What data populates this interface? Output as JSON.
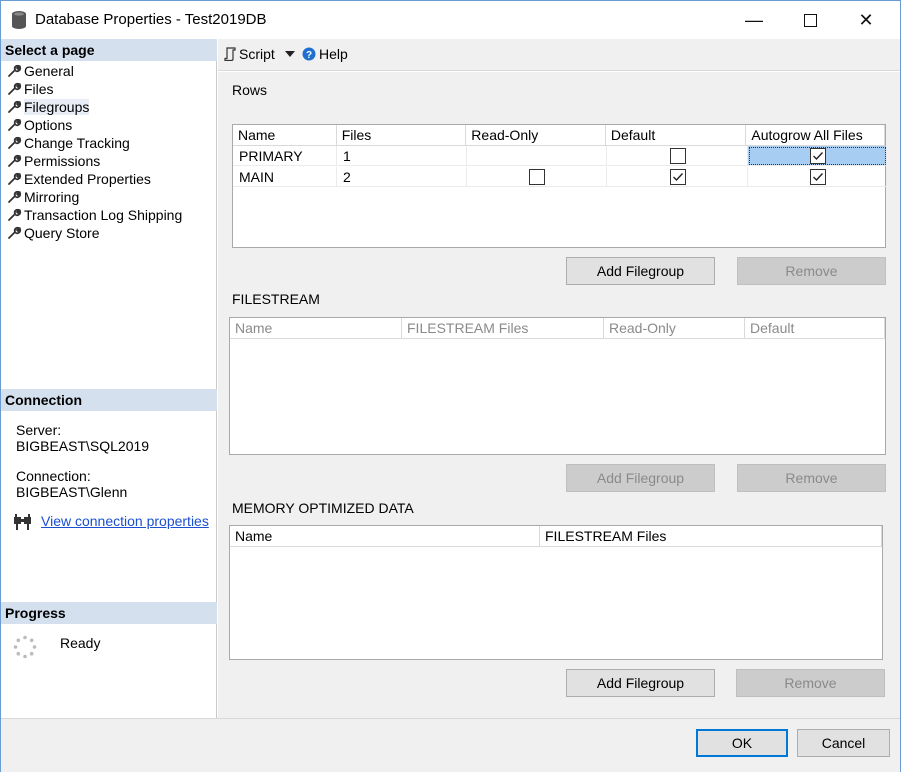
{
  "window": {
    "title": "Database Properties - Test2019DB",
    "minimize_glyph": "—",
    "close_glyph": "✕"
  },
  "left": {
    "select_page_header": "Select a page",
    "pages": [
      "General",
      "Files",
      "Filegroups",
      "Options",
      "Change Tracking",
      "Permissions",
      "Extended Properties",
      "Mirroring",
      "Transaction Log Shipping",
      "Query Store"
    ],
    "selected_page": "Filegroups",
    "connection_header": "Connection",
    "server_label": "Server:",
    "server_value": "BIGBEAST\\SQL2019",
    "connection_label": "Connection:",
    "connection_value": "BIGBEAST\\Glenn",
    "view_connection_link": "View connection properties",
    "progress_header": "Progress",
    "progress_status": "Ready"
  },
  "toolbar": {
    "script_label": "Script",
    "help_label": "Help"
  },
  "rows_section": {
    "label": "Rows",
    "columns": [
      "Name",
      "Files",
      "Read-Only",
      "Default",
      "Autogrow All Files"
    ],
    "rows": [
      {
        "name": "PRIMARY",
        "files": "1",
        "read_only": null,
        "default": false,
        "autogrow": true
      },
      {
        "name": "MAIN",
        "files": "2",
        "read_only": false,
        "default": true,
        "autogrow": true
      }
    ],
    "add_button": "Add Filegroup",
    "remove_button": "Remove"
  },
  "filestream_section": {
    "label": "FILESTREAM",
    "columns": [
      "Name",
      "FILESTREAM Files",
      "Read-Only",
      "Default"
    ],
    "add_button": "Add Filegroup",
    "remove_button": "Remove"
  },
  "memory_section": {
    "label": "MEMORY OPTIMIZED DATA",
    "columns": [
      "Name",
      "FILESTREAM Files"
    ],
    "add_button": "Add Filegroup",
    "remove_button": "Remove"
  },
  "footer": {
    "ok_button": "OK",
    "cancel_button": "Cancel"
  },
  "colors": {
    "section_header_bg": "#d5e0ee",
    "selected_cell_bg": "#a8cdf2",
    "link": "#1a4fcf",
    "ok_border": "#0078d7"
  }
}
